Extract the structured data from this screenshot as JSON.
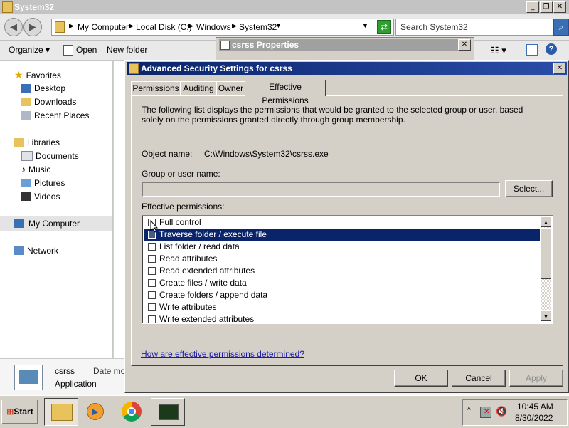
{
  "explorer": {
    "title": "System32",
    "address": [
      "My Computer",
      "Local Disk (C:)",
      "Windows",
      "System32"
    ],
    "search_placeholder": "Search System32",
    "toolbar": {
      "organize": "Organize",
      "open": "Open",
      "new_folder": "New folder"
    },
    "sidebar": {
      "favorites": "Favorites",
      "fav_items": [
        "Desktop",
        "Downloads",
        "Recent Places"
      ],
      "libraries": "Libraries",
      "lib_items": [
        "Documents",
        "Music",
        "Pictures",
        "Videos"
      ],
      "my_computer": "My Computer",
      "network": "Network"
    },
    "details": {
      "name": "csrss",
      "type": "Application",
      "date_label": "Date mod"
    }
  },
  "properties_window": {
    "title": "csrss Properties"
  },
  "dialog": {
    "title": "Advanced Security Settings for csrss",
    "tabs": [
      "Permissions",
      "Auditing",
      "Owner",
      "Effective Permissions"
    ],
    "description": "The following list displays the permissions that would be granted to the selected group or user, based solely on the permissions granted directly through group membership.",
    "object_name_label": "Object name:",
    "object_name_value": "C:\\Windows\\System32\\csrss.exe",
    "group_label": "Group or user name:",
    "group_value": "",
    "select_button": "Select...",
    "effective_label": "Effective permissions:",
    "permissions": [
      {
        "label": "Full control",
        "checked": false
      },
      {
        "label": "Traverse folder / execute file",
        "checked": false,
        "selected": true
      },
      {
        "label": "List folder / read data",
        "checked": false
      },
      {
        "label": "Read attributes",
        "checked": false
      },
      {
        "label": "Read extended attributes",
        "checked": false
      },
      {
        "label": "Create files / write data",
        "checked": false
      },
      {
        "label": "Create folders / append data",
        "checked": false
      },
      {
        "label": "Write attributes",
        "checked": false
      },
      {
        "label": "Write extended attributes",
        "checked": false
      }
    ],
    "help_link": "How are effective permissions determined?",
    "ok": "OK",
    "cancel": "Cancel",
    "apply": "Apply"
  },
  "taskbar": {
    "start": "Start",
    "time": "10:45 AM",
    "date": "8/30/2022"
  }
}
